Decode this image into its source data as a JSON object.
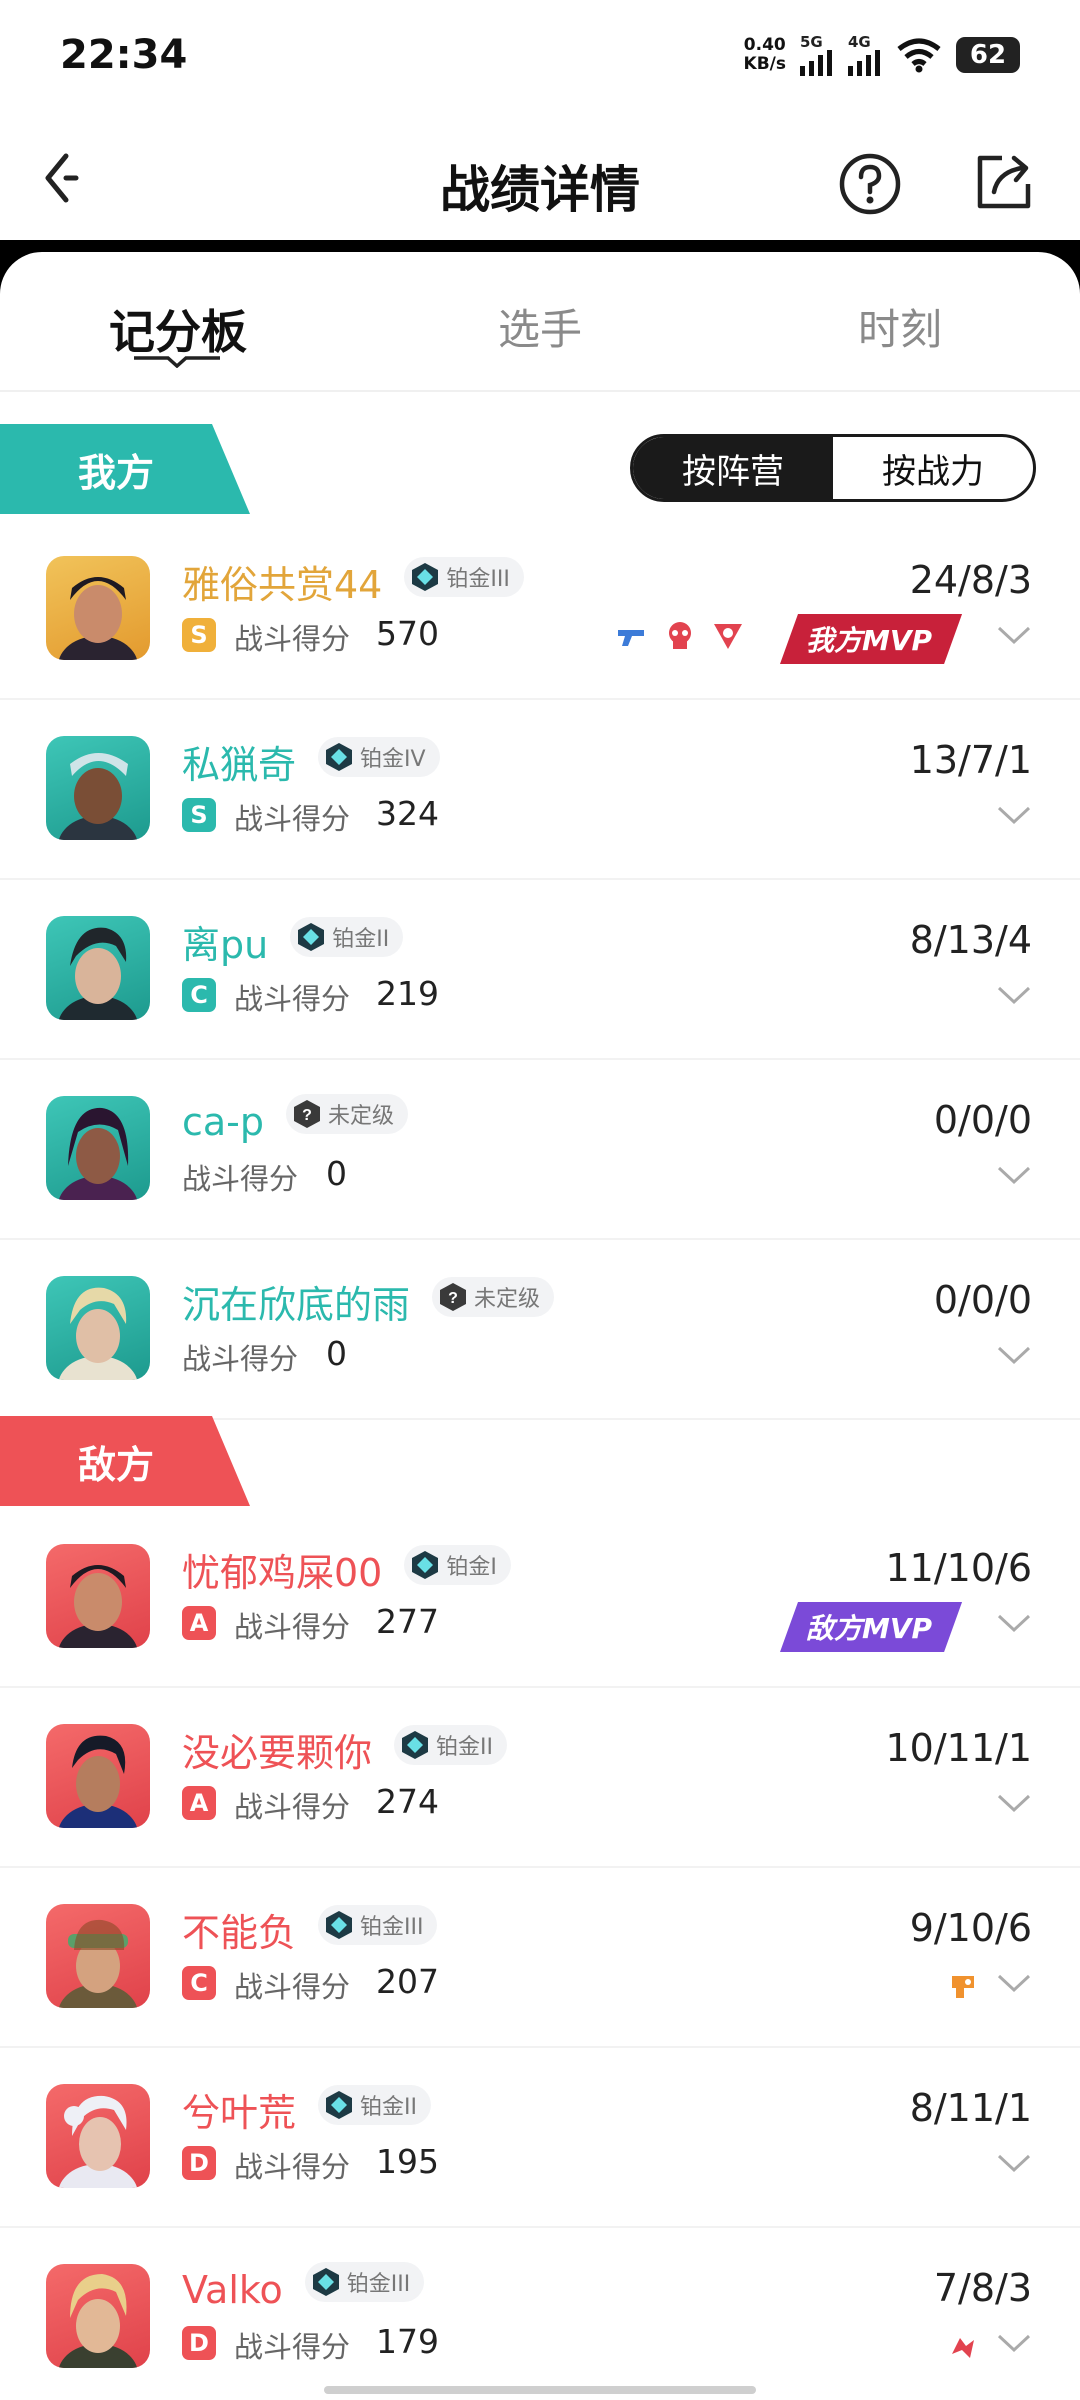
{
  "status_bar": {
    "time": "22:34",
    "speed_value": "0.40",
    "speed_unit": "KB/s",
    "sig1": "5G",
    "sig2": "4G",
    "battery": "62"
  },
  "nav": {
    "title": "战绩详情"
  },
  "tabs": [
    {
      "label": "记分板"
    },
    {
      "label": "选手"
    },
    {
      "label": "时刻"
    }
  ],
  "segment": {
    "camp": "按阵营",
    "power": "按战力"
  },
  "teams": {
    "ours": "我方",
    "enemy": "敌方"
  },
  "score_label": "战斗得分",
  "mvp": {
    "ours": "我方MVP",
    "enemy": "敌方MVP"
  },
  "players": [
    {
      "name": "雅俗共赏44",
      "rank": "铂金III",
      "grade": "S",
      "score": "570",
      "kda": "24/8/3"
    },
    {
      "name": "私猟奇",
      "rank": "铂金IV",
      "grade": "S",
      "score": "324",
      "kda": "13/7/1"
    },
    {
      "name": "离pu",
      "rank": "铂金II",
      "grade": "C",
      "score": "219",
      "kda": "8/13/4"
    },
    {
      "name": "ca-p",
      "rank": "未定级",
      "grade": "",
      "score": "0",
      "kda": "0/0/0"
    },
    {
      "name": "沉在欣底的雨",
      "rank": "未定级",
      "grade": "",
      "score": "0",
      "kda": "0/0/0"
    },
    {
      "name": "忧郁鸡屎00",
      "rank": "铂金I",
      "grade": "A",
      "score": "277",
      "kda": "11/10/6"
    },
    {
      "name": "没必要颗你",
      "rank": "铂金II",
      "grade": "A",
      "score": "274",
      "kda": "10/11/1"
    },
    {
      "name": "不能负",
      "rank": "铂金III",
      "grade": "C",
      "score": "207",
      "kda": "9/10/6"
    },
    {
      "name": "兮叶荒",
      "rank": "铂金II",
      "grade": "D",
      "score": "195",
      "kda": "8/11/1"
    },
    {
      "name": "Valko",
      "rank": "铂金III",
      "grade": "D",
      "score": "179",
      "kda": "7/8/3"
    }
  ],
  "colors": {
    "ours_accent": "#2bb9ad",
    "enemy_accent": "#ee5256",
    "top_name": "#e2a53a",
    "grade_ours": "#2bb9ad",
    "grade_enemy": "#ee5256",
    "grade_top": "#f0b03a"
  },
  "icons": [
    "back-icon",
    "help-icon",
    "share-icon",
    "rank-gem-icon",
    "unranked-icon",
    "chevron-down-icon",
    "gun-icon",
    "skull-icon",
    "triangle-icon"
  ]
}
